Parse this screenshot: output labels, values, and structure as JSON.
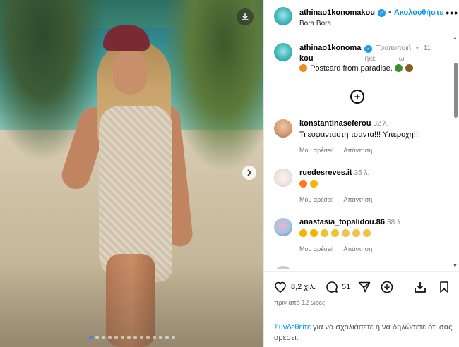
{
  "post": {
    "image_alt": "Woman in a knitted beach dress on a tropical beach",
    "carousel": {
      "dots": 14,
      "active": 0
    }
  },
  "header": {
    "username": "athinao1konomakou",
    "separator": "•",
    "follow_label": "Ακολουθήστε",
    "location": "Bora Bora",
    "more_label": "•••"
  },
  "caption": {
    "username_line1": "athinao1konoma",
    "username_line2": "kou",
    "edited": "Τροποποιή",
    "edited2": "ηκε",
    "dot": "•",
    "time1": "11",
    "time2": "ω",
    "text": "Postcard from paradise. "
  },
  "comments": [
    {
      "username": "konstantinaseferou",
      "time": "32 λ.",
      "text": "Τι ευφανταστη τσαντα!!! Υπεροχη!!!",
      "like": "Μου αρέσει!",
      "reply": "Απάντηση"
    },
    {
      "username": "ruedesreves.it",
      "time": "35 λ.",
      "text": "",
      "like": "Μου αρέσει!",
      "reply": "Απάντηση"
    },
    {
      "username": "anastasia_topalidou.86",
      "time": "38 λ.",
      "text": "",
      "like": "Μου αρέσει!",
      "reply": "Απάντηση"
    }
  ],
  "actions": {
    "likes": "8,2 χιλ.",
    "comments": "51",
    "ago": "πριν από 12 ώρες"
  },
  "login": {
    "link": "Συνδεθείτε",
    "rest": " για να σχολιάσετε ή να δηλώσετε ότι σας αρέσει."
  },
  "colors": {
    "link": "#0095f6",
    "muted": "#737373",
    "verified": "#1d9bf0"
  },
  "icons": [
    "download-icon",
    "chevron-right-icon",
    "verified-icon",
    "more-icon",
    "add-comment-icon",
    "heart-icon",
    "comment-icon",
    "share-icon",
    "bookmark-icon",
    "repost-icon"
  ]
}
